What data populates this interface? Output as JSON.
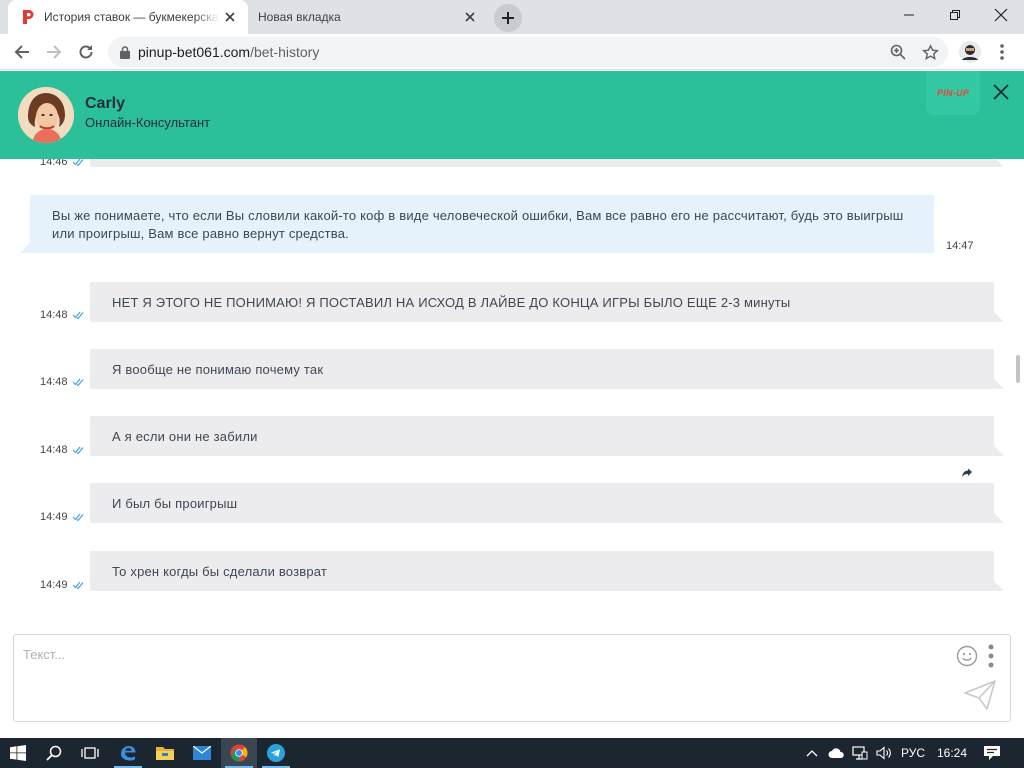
{
  "browser": {
    "tabs": [
      {
        "title": "История ставок — букмекерская контора",
        "active": true
      },
      {
        "title": "Новая вкладка",
        "active": false
      }
    ],
    "url": {
      "host": "pinup-bet061.com",
      "path": "/bet-history"
    }
  },
  "chat": {
    "agent_name": "Carly",
    "agent_role": "Онлайн-Консультант",
    "logo_text": "PIN-UP",
    "messages": [
      {
        "side": "user",
        "text": "",
        "time": "14:46"
      },
      {
        "side": "agent",
        "text": "Вы же понимаете, что если Вы словили какой-то коф в виде человеческой ошибки, Вам все равно его не рассчитают, будь это выигрыш или проигрыш, Вам все равно вернут средства.",
        "time": "14:47"
      },
      {
        "side": "user",
        "text": "НЕТ Я ЭТОГО НЕ ПОНИМАЮ! Я ПОСТАВИЛ НА ИСХОД В ЛАЙВЕ ДО КОНЦА ИГРЫ БЫЛО ЕЩЕ 2-3 минуты",
        "time": "14:48"
      },
      {
        "side": "user",
        "text": "Я вообще не понимаю почему так",
        "time": "14:48"
      },
      {
        "side": "user",
        "text": "А я если они не забили",
        "time": "14:48"
      },
      {
        "side": "user",
        "text": "И был бы проигрыш",
        "time": "14:49"
      },
      {
        "side": "user",
        "text": "То хрен когды бы сделали возврат",
        "time": "14:49"
      }
    ],
    "input_placeholder": "Текст..."
  },
  "taskbar": {
    "language": "РУС",
    "clock": "16:24"
  },
  "colors": {
    "header": "#2bbf9a",
    "agent_bubble": "#e5f1fb",
    "user_bubble": "#ececee",
    "taskbar": "#1c2630"
  }
}
